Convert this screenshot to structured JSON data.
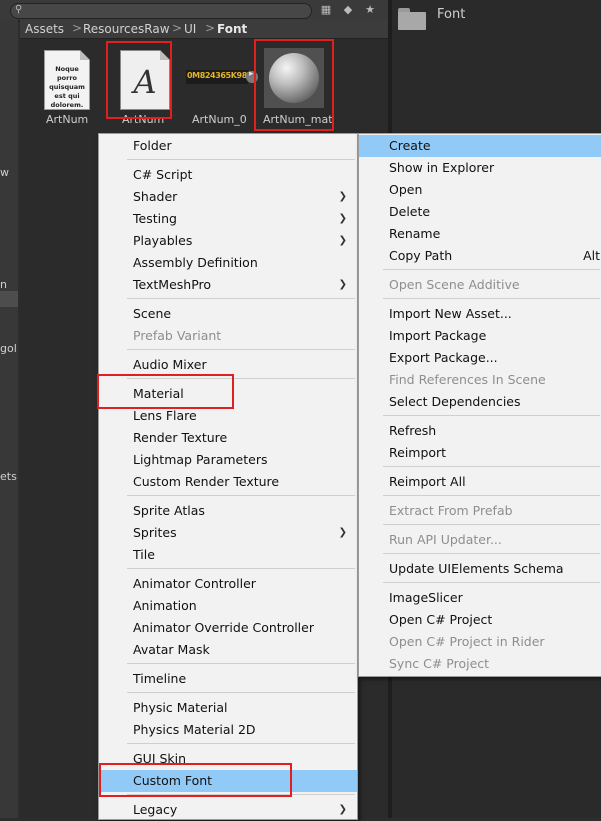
{
  "breadcrumb": [
    "Assets",
    "ResourcesRaw",
    "UI",
    "Font"
  ],
  "right_panel": {
    "folder_label": "Font"
  },
  "left_strip": [
    "w",
    "n",
    "gol",
    "ets"
  ],
  "assets": [
    {
      "label": "ArtNum",
      "preview_text": "Noque porro quisquam est qui dolorem."
    },
    {
      "label": "ArtNum",
      "glyph": "A"
    },
    {
      "label": "ArtNum_0",
      "preview_text": "0M824365K987"
    },
    {
      "label": "ArtNum_mat"
    }
  ],
  "create_menu": {
    "items": [
      {
        "label": "Folder"
      },
      {
        "label": "C# Script"
      },
      {
        "label": "Shader",
        "submenu": true
      },
      {
        "label": "Testing",
        "submenu": true
      },
      {
        "label": "Playables",
        "submenu": true
      },
      {
        "label": "Assembly Definition"
      },
      {
        "label": "TextMeshPro",
        "submenu": true
      },
      {
        "label": "Scene"
      },
      {
        "label": "Prefab Variant",
        "disabled": true
      },
      {
        "label": "Audio Mixer"
      },
      {
        "label": "Material"
      },
      {
        "label": "Lens Flare"
      },
      {
        "label": "Render Texture"
      },
      {
        "label": "Lightmap Parameters"
      },
      {
        "label": "Custom Render Texture"
      },
      {
        "label": "Sprite Atlas"
      },
      {
        "label": "Sprites",
        "submenu": true
      },
      {
        "label": "Tile"
      },
      {
        "label": "Animator Controller"
      },
      {
        "label": "Animation"
      },
      {
        "label": "Animator Override Controller"
      },
      {
        "label": "Avatar Mask"
      },
      {
        "label": "Timeline"
      },
      {
        "label": "Physic Material"
      },
      {
        "label": "Physics Material 2D"
      },
      {
        "label": "GUI Skin"
      },
      {
        "label": "Custom Font",
        "highlighted": true
      },
      {
        "label": "Legacy",
        "submenu": true
      }
    ]
  },
  "context_menu": {
    "items": [
      {
        "label": "Create",
        "highlighted": true
      },
      {
        "label": "Show in Explorer"
      },
      {
        "label": "Open"
      },
      {
        "label": "Delete"
      },
      {
        "label": "Rename"
      },
      {
        "label": "Copy Path",
        "shortcut": "Alt"
      },
      {
        "label": "Open Scene Additive",
        "disabled": true
      },
      {
        "label": "Import New Asset..."
      },
      {
        "label": "Import Package"
      },
      {
        "label": "Export Package..."
      },
      {
        "label": "Find References In Scene",
        "disabled": true
      },
      {
        "label": "Select Dependencies"
      },
      {
        "label": "Refresh"
      },
      {
        "label": "Reimport"
      },
      {
        "label": "Reimport All"
      },
      {
        "label": "Extract From Prefab",
        "disabled": true
      },
      {
        "label": "Run API Updater...",
        "disabled": true
      },
      {
        "label": "Update UIElements Schema"
      },
      {
        "label": "ImageSlicer"
      },
      {
        "label": "Open C# Project"
      },
      {
        "label": "Open C# Project in Rider",
        "disabled": true
      },
      {
        "label": "Sync C# Project",
        "disabled": true
      }
    ]
  },
  "colors": {
    "highlight": "#91c9f7",
    "annotation_red": "#e02020",
    "menu_bg": "#f2f2f2",
    "editor_bg": "#2d2d2d"
  }
}
